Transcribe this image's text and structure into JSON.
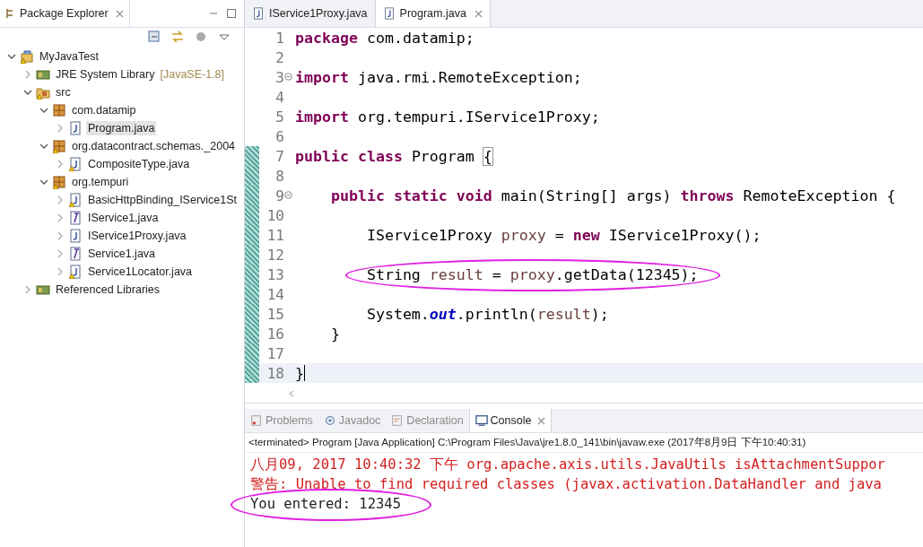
{
  "explorer": {
    "title": "Package Explorer",
    "tree": [
      {
        "label": "MyJavaTest",
        "kind": "project",
        "expanded": true,
        "selected": false,
        "warning": true,
        "children": [
          {
            "label": "JRE System Library",
            "suffix": "[JavaSE-1.8]",
            "kind": "library",
            "expanded": false,
            "selected": false,
            "warning": false
          },
          {
            "label": "src",
            "kind": "source-folder",
            "expanded": true,
            "selected": false,
            "warning": true,
            "children": [
              {
                "label": "com.datamip",
                "kind": "package",
                "expanded": true,
                "selected": false,
                "warning": false,
                "children": [
                  {
                    "label": "Program.java",
                    "kind": "class-file",
                    "expanded": false,
                    "selected": true,
                    "warning": false
                  }
                ]
              },
              {
                "label": "org.datacontract.schemas._2004",
                "kind": "package",
                "expanded": true,
                "selected": false,
                "warning": true,
                "children": [
                  {
                    "label": "CompositeType.java",
                    "kind": "class-file",
                    "expanded": false,
                    "selected": false,
                    "warning": true
                  }
                ]
              },
              {
                "label": "org.tempuri",
                "kind": "package",
                "expanded": true,
                "selected": false,
                "warning": true,
                "children": [
                  {
                    "label": "BasicHttpBinding_IService1St",
                    "kind": "class-file",
                    "expanded": false,
                    "selected": false,
                    "warning": true
                  },
                  {
                    "label": "IService1.java",
                    "kind": "interface-file",
                    "expanded": false,
                    "selected": false,
                    "warning": false
                  },
                  {
                    "label": "IService1Proxy.java",
                    "kind": "class-file",
                    "expanded": false,
                    "selected": false,
                    "warning": false
                  },
                  {
                    "label": "Service1.java",
                    "kind": "interface-file",
                    "expanded": false,
                    "selected": false,
                    "warning": false
                  },
                  {
                    "label": "Service1Locator.java",
                    "kind": "class-file",
                    "expanded": false,
                    "selected": false,
                    "warning": true
                  }
                ]
              }
            ]
          },
          {
            "label": "Referenced Libraries",
            "kind": "library",
            "expanded": false,
            "selected": false,
            "warning": false
          }
        ]
      }
    ]
  },
  "editor": {
    "tabs": [
      {
        "label": "IService1Proxy.java",
        "selected": false
      },
      {
        "label": "Program.java",
        "selected": true
      }
    ],
    "lines": [
      {
        "number": "1",
        "changed": false,
        "tokens": [
          {
            "kind": "keyword",
            "text": "package"
          },
          {
            "kind": "plain",
            "text": " com.datamip;"
          }
        ]
      },
      {
        "number": "2",
        "changed": false
      },
      {
        "number": "3",
        "changed": false,
        "fold": true,
        "tokens": [
          {
            "kind": "keyword",
            "text": "import"
          },
          {
            "kind": "plain",
            "text": " java.rmi.RemoteException;"
          }
        ]
      },
      {
        "number": "4",
        "changed": false
      },
      {
        "number": "5",
        "changed": false,
        "tokens": [
          {
            "kind": "keyword",
            "text": "import"
          },
          {
            "kind": "plain",
            "text": " org.tempuri.IService1Proxy;"
          }
        ]
      },
      {
        "number": "6",
        "changed": false
      },
      {
        "number": "7",
        "changed": true,
        "tokens": [
          {
            "kind": "keyword",
            "text": "public class"
          },
          {
            "kind": "plain",
            "text": " Program "
          },
          {
            "kind": "bracket",
            "text": "{"
          }
        ]
      },
      {
        "number": "8",
        "changed": true
      },
      {
        "number": "9",
        "changed": true,
        "fold": true,
        "tokens": [
          {
            "kind": "keyword",
            "text": "    public static void"
          },
          {
            "kind": "plain",
            "text": " main(String[] args) "
          },
          {
            "kind": "keyword",
            "text": "throws"
          },
          {
            "kind": "plain",
            "text": " RemoteException {"
          }
        ]
      },
      {
        "number": "10",
        "changed": true
      },
      {
        "number": "11",
        "changed": true,
        "tokens": [
          {
            "kind": "plain",
            "text": "        IService1Proxy "
          },
          {
            "kind": "local",
            "text": "proxy"
          },
          {
            "kind": "plain",
            "text": " = "
          },
          {
            "kind": "keyword",
            "text": "new"
          },
          {
            "kind": "plain",
            "text": " IService1Proxy();"
          }
        ]
      },
      {
        "number": "12",
        "changed": true
      },
      {
        "number": "13",
        "changed": true,
        "circled": true,
        "tokens": [
          {
            "kind": "plain",
            "text": "        String "
          },
          {
            "kind": "local",
            "text": "result"
          },
          {
            "kind": "plain",
            "text": " = "
          },
          {
            "kind": "local",
            "text": "proxy"
          },
          {
            "kind": "plain",
            "text": ".getData(12345);"
          }
        ]
      },
      {
        "number": "14",
        "changed": true
      },
      {
        "number": "15",
        "changed": true,
        "tokens": [
          {
            "kind": "plain",
            "text": "        System."
          },
          {
            "kind": "static",
            "text": "out"
          },
          {
            "kind": "plain",
            "text": ".println("
          },
          {
            "kind": "local",
            "text": "result"
          },
          {
            "kind": "plain",
            "text": ");"
          }
        ]
      },
      {
        "number": "16",
        "changed": true,
        "tokens": [
          {
            "kind": "plain",
            "text": "    }"
          }
        ]
      },
      {
        "number": "17",
        "changed": true
      },
      {
        "number": "18",
        "changed": true,
        "current": true,
        "tokens": [
          {
            "kind": "plain",
            "text": "}"
          }
        ]
      }
    ]
  },
  "bottom": {
    "tabs": [
      {
        "label": "Problems",
        "kind": "problems",
        "selected": false
      },
      {
        "label": "Javadoc",
        "kind": "at",
        "selected": false
      },
      {
        "label": "Declaration",
        "kind": "declaration",
        "selected": false
      },
      {
        "label": "Console",
        "kind": "console",
        "selected": true
      }
    ],
    "status": "<terminated> Program [Java Application] C:\\Program Files\\Java\\jre1.8.0_141\\bin\\javaw.exe (2017年8月9日 下午10:40:31)",
    "output": [
      {
        "kind": "error",
        "text": "八月09, 2017 10:40:32 下午 org.apache.axis.utils.JavaUtils isAttachmentSuppor"
      },
      {
        "kind": "error",
        "text": "警告: Unable to find required classes (javax.activation.DataHandler and java"
      },
      {
        "kind": "normal",
        "text": "You entered: 12345",
        "circled": true
      }
    ]
  }
}
